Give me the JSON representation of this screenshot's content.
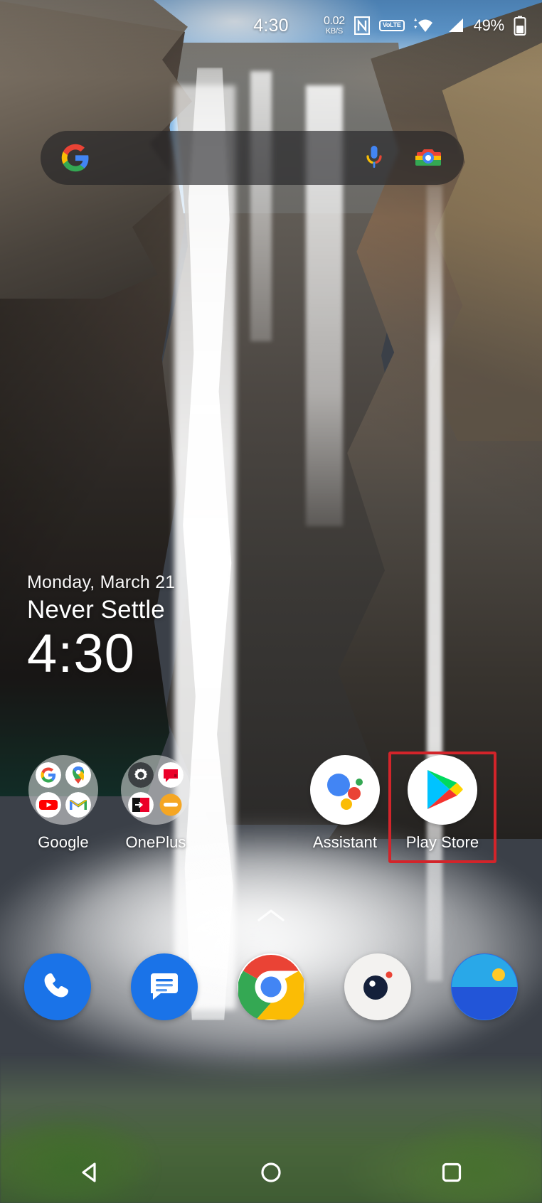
{
  "status_bar": {
    "time": "4:30",
    "network_speed_value": "0.02",
    "network_speed_unit": "KB/S",
    "nfc_icon": "nfc-icon",
    "volte_line1": "Vo",
    "volte_line2": "LTE",
    "wifi_icon": "wifi-icon",
    "signal_icon": "cellular-signal-icon",
    "battery_percent": "49%",
    "battery_icon": "battery-icon"
  },
  "search_widget": {
    "google_icon": "google-g-icon",
    "mic_icon": "microphone-icon",
    "lens_icon": "google-lens-camera-icon",
    "placeholder": ""
  },
  "clock_widget": {
    "date": "Monday, March 21",
    "tagline": "Never Settle",
    "time": "4:30"
  },
  "home_apps": [
    {
      "label": "Google",
      "type": "folder",
      "items": [
        "google-search-icon",
        "google-maps-icon",
        "youtube-icon",
        "gmail-icon"
      ]
    },
    {
      "label": "OnePlus",
      "type": "folder",
      "items": [
        "settings-gear-icon",
        "community-message-icon",
        "switch-transfer-icon",
        "zen-mode-icon"
      ]
    },
    {
      "label": "Assistant",
      "type": "app",
      "icon": "google-assistant-icon"
    },
    {
      "label": "Play Store",
      "type": "app",
      "icon": "google-play-store-icon"
    }
  ],
  "highlight": {
    "target_label": "Play Store",
    "color": "#d3242a"
  },
  "drawer": {
    "chevron_icon": "chevron-up-icon"
  },
  "dock_apps": [
    {
      "label": "Phone",
      "icon": "phone-icon",
      "color": "#1a73e8"
    },
    {
      "label": "Messages",
      "icon": "messages-icon",
      "color": "#1a73e8"
    },
    {
      "label": "Chrome",
      "icon": "chrome-icon",
      "color": "#ffffff"
    },
    {
      "label": "Camera",
      "icon": "camera-icon",
      "color": "#f1f1f1"
    },
    {
      "label": "Gallery",
      "icon": "gallery-photos-icon",
      "color": "#2b6fe8"
    }
  ],
  "nav_bar": [
    {
      "label": "Back",
      "icon": "back-triangle-icon"
    },
    {
      "label": "Home",
      "icon": "home-circle-icon"
    },
    {
      "label": "Recents",
      "icon": "recents-square-icon"
    }
  ],
  "wallpaper": {
    "description": "waterfall-cliff-photo"
  }
}
